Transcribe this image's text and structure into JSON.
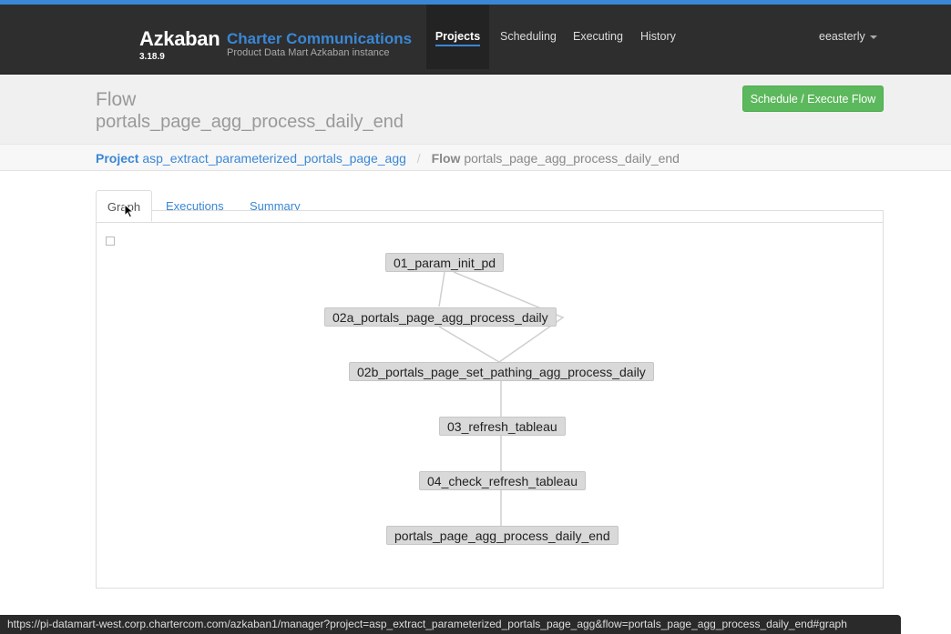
{
  "app": {
    "brand": "Azkaban",
    "version": "3.18.9",
    "org": "Charter Communications",
    "subtitle": "Product Data Mart Azkaban instance"
  },
  "nav": {
    "items": [
      {
        "label": "Projects",
        "active": true
      },
      {
        "label": "Scheduling"
      },
      {
        "label": "Executing"
      },
      {
        "label": "History"
      }
    ],
    "user": "eeasterly"
  },
  "header": {
    "label": "Flow",
    "flow_name": "portals_page_agg_process_daily_end",
    "action_button": "Schedule / Execute Flow"
  },
  "breadcrumb": {
    "project_key": "Project",
    "project_value": "asp_extract_parameterized_portals_page_agg",
    "separator": "/",
    "flow_key": "Flow",
    "flow_value": "portals_page_agg_process_daily_end"
  },
  "tabs": [
    {
      "label": "Graph",
      "active": true
    },
    {
      "label": "Executions"
    },
    {
      "label": "Summary"
    }
  ],
  "graph": {
    "nodes": [
      {
        "id": "n1",
        "label": "01_param_init_pd"
      },
      {
        "id": "n2",
        "label": "02a_portals_page_agg_process_daily"
      },
      {
        "id": "n3",
        "label": "02b_portals_page_set_pathing_agg_process_daily"
      },
      {
        "id": "n4",
        "label": "03_refresh_tableau"
      },
      {
        "id": "n5",
        "label": "04_check_refresh_tableau"
      },
      {
        "id": "n6",
        "label": "portals_page_agg_process_daily_end"
      }
    ]
  },
  "statusbar": {
    "url": "https://pi-datamart-west.corp.chartercom.com/azkaban1/manager?project=asp_extract_parameterized_portals_page_agg&flow=portals_page_agg_process_daily_end#graph"
  },
  "colors": {
    "accent": "#3a87d6",
    "navbar": "#2e2e2e",
    "success": "#5cb85c"
  }
}
